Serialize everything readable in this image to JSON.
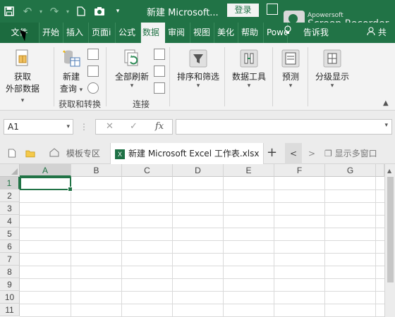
{
  "titlebar": {
    "doc_title": "新建 Microsoft...",
    "login_label": "登录",
    "watermark_small": "Apowersoft",
    "watermark_large": "Screen Recorder"
  },
  "tabs": [
    {
      "label": "文件",
      "active": false
    },
    {
      "label": "开始",
      "active": false
    },
    {
      "label": "插入",
      "active": false
    },
    {
      "label": "页面i",
      "active": false
    },
    {
      "label": "公式",
      "active": false
    },
    {
      "label": "数据",
      "active": true
    },
    {
      "label": "审阅",
      "active": false
    },
    {
      "label": "视图",
      "active": false
    },
    {
      "label": "美化",
      "active": false
    },
    {
      "label": "帮助",
      "active": false
    },
    {
      "label": "Powe",
      "active": false
    }
  ],
  "tell_me": "告诉我",
  "share": "共",
  "ribbon": {
    "get_external_line1": "获取",
    "get_external_line2": "外部数据",
    "new_query_line1": "新建",
    "new_query_line2": "查询",
    "group_get_transform": "获取和转换",
    "refresh_all": "全部刷新",
    "group_connections": "连接",
    "sort_filter": "排序和筛选",
    "data_tools": "数据工具",
    "forecast": "预测",
    "outline": "分级显示"
  },
  "formula_bar": {
    "name_box": "A1",
    "cancel_glyph": "✕",
    "enter_glyph": "✓",
    "fx_label": "fx",
    "formula_value": ""
  },
  "doc_tabs": {
    "template_zone": "模板专区",
    "active_file": "新建 Microsoft Excel 工作表.xlsx",
    "xl_badge": "X",
    "show_multi": "显示多窗口"
  },
  "sheet": {
    "columns": [
      "A",
      "B",
      "C",
      "D",
      "E",
      "F",
      "G"
    ],
    "rows": [
      "1",
      "2",
      "3",
      "4",
      "5",
      "6",
      "7",
      "8",
      "9",
      "10",
      "11"
    ],
    "selected_cell": "A1"
  },
  "colors": {
    "brand": "#217346",
    "tab_bg": "#f3f3f3"
  }
}
